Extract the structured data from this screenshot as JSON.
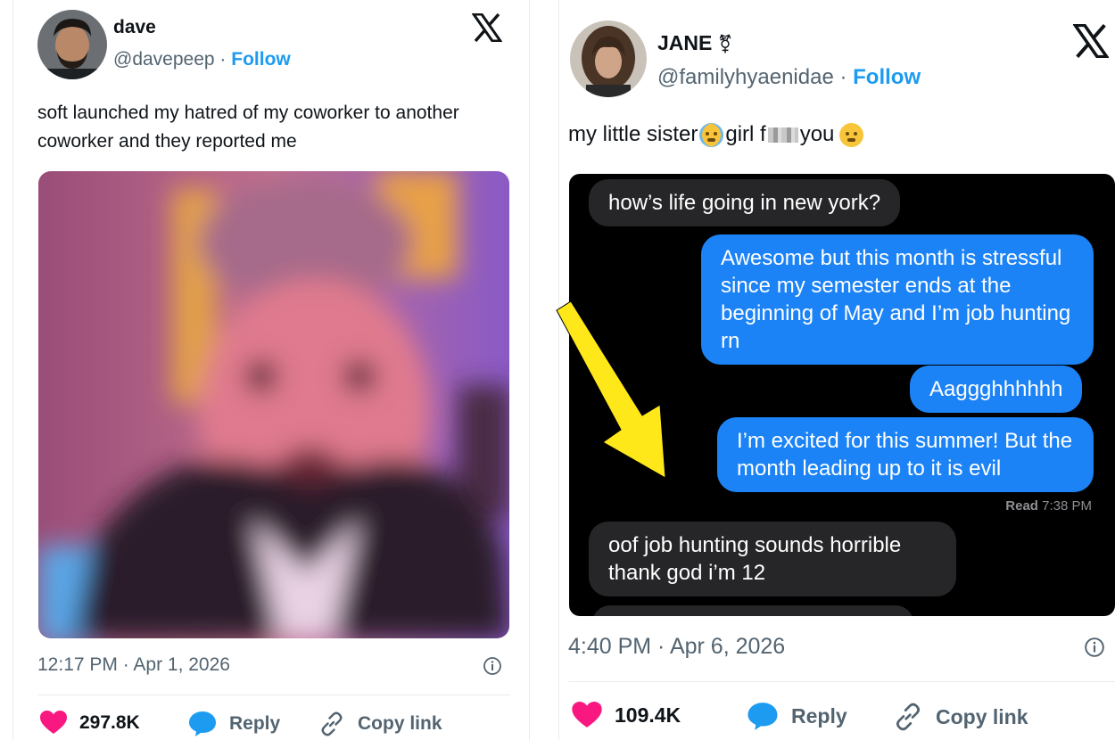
{
  "left_tweet": {
    "name": "dave",
    "handle": "@davepeep",
    "separator": " · ",
    "follow": "Follow",
    "text": "soft launched my hatred of my coworker to another coworker and they reported me",
    "timestamp": "12:17 PM · Apr 1, 2026",
    "likes": "297.8K",
    "reply": "Reply",
    "copy_link": "Copy link"
  },
  "right_tweet": {
    "name": "JANE",
    "name_symbol": "⚧",
    "handle": "@familyhyaenidae",
    "separator": " · ",
    "follow": "Follow",
    "text_part1": "my little sister",
    "text_part2": "girl f",
    "text_part3": " you",
    "timestamp": "4:40 PM · Apr 6, 2026",
    "likes": "109.4K",
    "reply": "Reply",
    "copy_link": "Copy link",
    "messages": [
      {
        "from": "them",
        "text": "how’s life going in new york?"
      },
      {
        "from": "me",
        "text": "Awesome but this month is stressful since my semester ends at the beginning of May and I’m job hunting rn"
      },
      {
        "from": "me",
        "text": "Aaggghhhhhh"
      },
      {
        "from": "me",
        "text": "I’m excited for this summer! But the month leading up to it is evil"
      },
      {
        "from": "them",
        "text": "oof job hunting sounds horrible thank god i’m 12"
      }
    ],
    "read_label": "Read",
    "read_time": "7:38 PM"
  },
  "colors": {
    "follow": "#1d9bf0",
    "like_heart": "#f91880",
    "reply_bubble": "#1d9bf0",
    "imessage_out": "#1c83f6",
    "imessage_in": "#262628",
    "arrow": "#ffe81a"
  },
  "icons": {
    "x_logo": "x-logo-icon",
    "info": "info-icon",
    "like": "heart-icon",
    "reply": "speech-bubble-icon",
    "copy": "link-icon"
  }
}
